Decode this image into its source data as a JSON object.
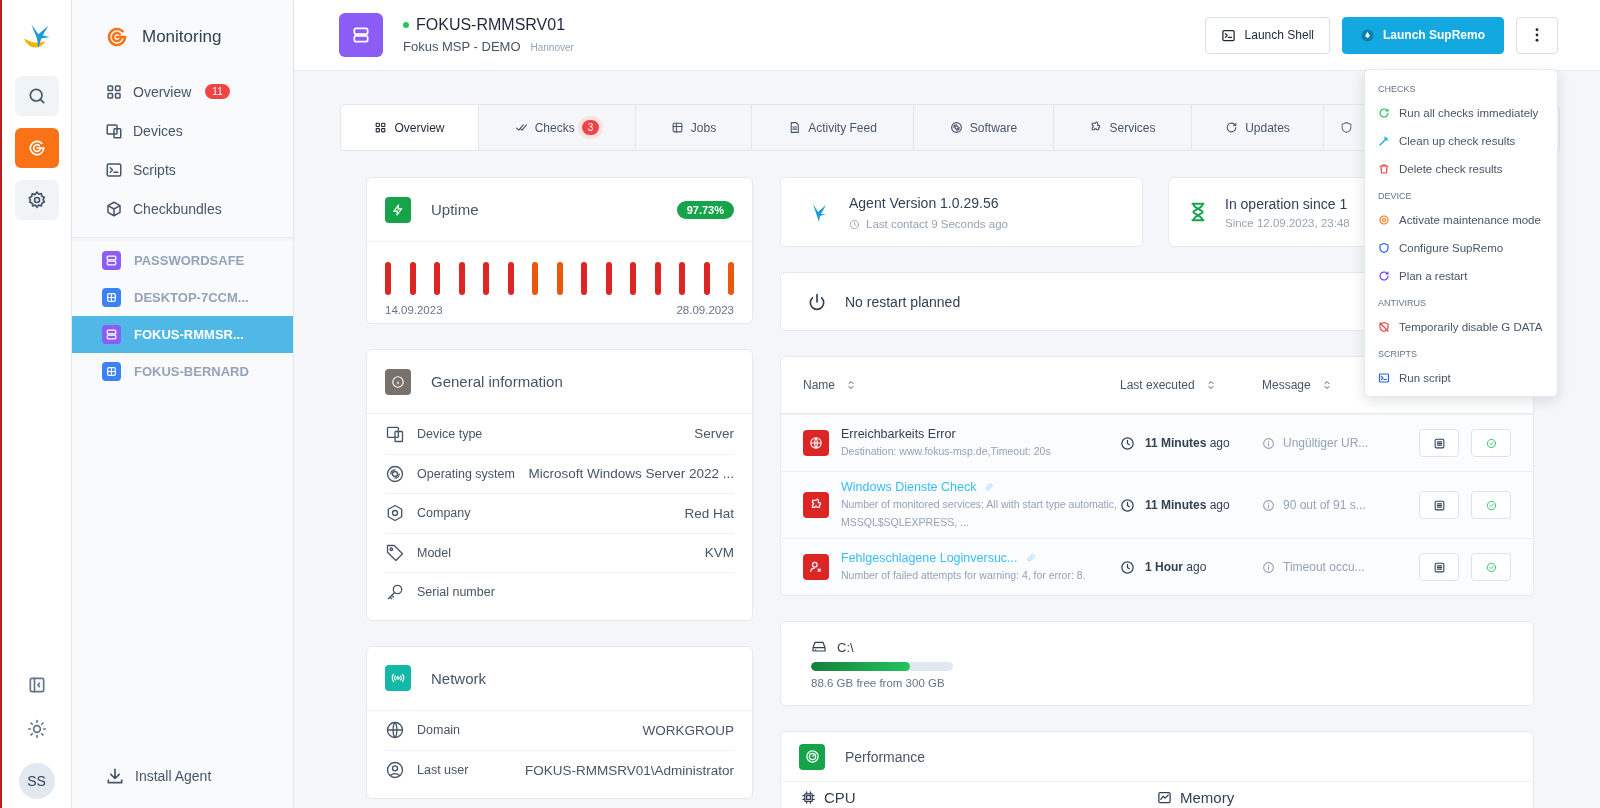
{
  "rail": {
    "apps": [
      {
        "selected": false
      },
      {
        "selected": true
      },
      {
        "selected": false
      }
    ],
    "avatar": "SS"
  },
  "nav": {
    "title": "Monitoring",
    "items": [
      {
        "label": "Overview",
        "badge": "11"
      },
      {
        "label": "Devices"
      },
      {
        "label": "Scripts"
      },
      {
        "label": "Checkbundles"
      }
    ],
    "devices": [
      {
        "name": "PASSWORDSAFE",
        "kind": "server",
        "selected": false
      },
      {
        "name": "DESKTOP-7CCM...",
        "kind": "windows",
        "selected": false
      },
      {
        "name": "FOKUS-RMMSR...",
        "kind": "server",
        "selected": true
      },
      {
        "name": "FOKUS-BERNARD",
        "kind": "windows",
        "selected": false
      }
    ],
    "install": "Install Agent"
  },
  "header": {
    "name": "FOKUS-RMMSRV01",
    "online": true,
    "company": "Fokus MSP - DEMO",
    "location": "Hannover",
    "buttons": [
      "Launch Shell",
      "Launch SupRemo"
    ]
  },
  "tabs": [
    {
      "label": "Overview",
      "selected": true
    },
    {
      "label": "Checks",
      "badge": "3",
      "selected": false
    },
    {
      "label": "Jobs",
      "selected": false
    },
    {
      "label": "Activity Feed",
      "selected": false
    },
    {
      "label": "Software",
      "selected": false
    },
    {
      "label": "Services",
      "selected": false
    },
    {
      "label": "Updates",
      "selected": false
    }
  ],
  "uptime": {
    "title": "Uptime",
    "percent": "97.73%",
    "start": "14.09.2023",
    "end": "28.09.2023",
    "days": [
      {
        "color": "#dc2626"
      },
      {
        "color": "#dc2626"
      },
      {
        "color": "#dc2626"
      },
      {
        "color": "#dc2626"
      },
      {
        "color": "#dc2626"
      },
      {
        "color": "#dc2626"
      },
      {
        "color": "#ea580c"
      },
      {
        "color": "#ea580c"
      },
      {
        "color": "#dc2626"
      },
      {
        "color": "#dc2626"
      },
      {
        "color": "#dc2626"
      },
      {
        "color": "#dc2626"
      },
      {
        "color": "#dc2626"
      },
      {
        "color": "#dc2626"
      },
      {
        "color": "#ea580c"
      }
    ]
  },
  "general": {
    "title": "General information",
    "rows": [
      {
        "label": "Device type",
        "value": "Server"
      },
      {
        "label": "Operating system",
        "value": "Microsoft Windows Server 2022 ..."
      },
      {
        "label": "Company",
        "value": "Red Hat"
      },
      {
        "label": "Model",
        "value": "KVM"
      },
      {
        "label": "Serial number"
      }
    ]
  },
  "network": {
    "title": "Network",
    "rows": [
      {
        "label": "Domain",
        "value": "WORKGROUP"
      },
      {
        "label": "Last user",
        "value": "FOKUS-RMMSRV01\\Administrator"
      }
    ]
  },
  "agent": {
    "version": "Agent Version 1.0.29.56",
    "contact": "Last contact 9 Seconds ago"
  },
  "operation": {
    "title": "In operation since 1",
    "since": "Since 12.09.2023, 23:48"
  },
  "restart": {
    "text": "No restart planned"
  },
  "checks": {
    "columns": [
      "Name",
      "Last executed",
      "Message"
    ],
    "rows": [
      {
        "kind": "globe",
        "name": "Erreichbarkeits Error",
        "linked": false,
        "description": "Destination: www.fokus-msp.de,Timeout: 20s",
        "last_executed": "**11 Minutes** ago",
        "message": "Ungültiger UR..."
      },
      {
        "kind": "puzzle",
        "name": "Windows Dienste Check",
        "linked": true,
        "description": "Number of monitored services: All with start type automatic, MSSQL$SQLEXPRESS, ...",
        "last_executed": "**11 Minutes** ago",
        "message": "90 out of 91 s..."
      },
      {
        "kind": "user-x",
        "name": "Fehlgeschlagene Loginversuc...",
        "linked": true,
        "description": "Number of failed attempts for warning: 4, for error: 8.",
        "last_executed": "**1 Hour** ago",
        "message": "Timeout occu..."
      }
    ]
  },
  "disk": {
    "name": "C:\\",
    "level": 0.7,
    "info": "88.6 GB free from 300 GB"
  },
  "performance": {
    "title": "Performance",
    "metrics": [
      "CPU",
      "Memory"
    ]
  },
  "menu": {
    "sections": [
      {
        "title": "CHECKS",
        "items": [
          "Run all checks immediately",
          "Clean up check results",
          "Delete check results"
        ]
      },
      {
        "title": "DEVICE",
        "items": [
          "Activate maintenance mode",
          "Configure SupRemo",
          "Plan a restart"
        ]
      },
      {
        "title": "ANTIVIRUS",
        "items": [
          "Temporarily disable G DATA"
        ]
      },
      {
        "title": "SCRIPTS",
        "items": [
          "Run script"
        ]
      }
    ]
  }
}
